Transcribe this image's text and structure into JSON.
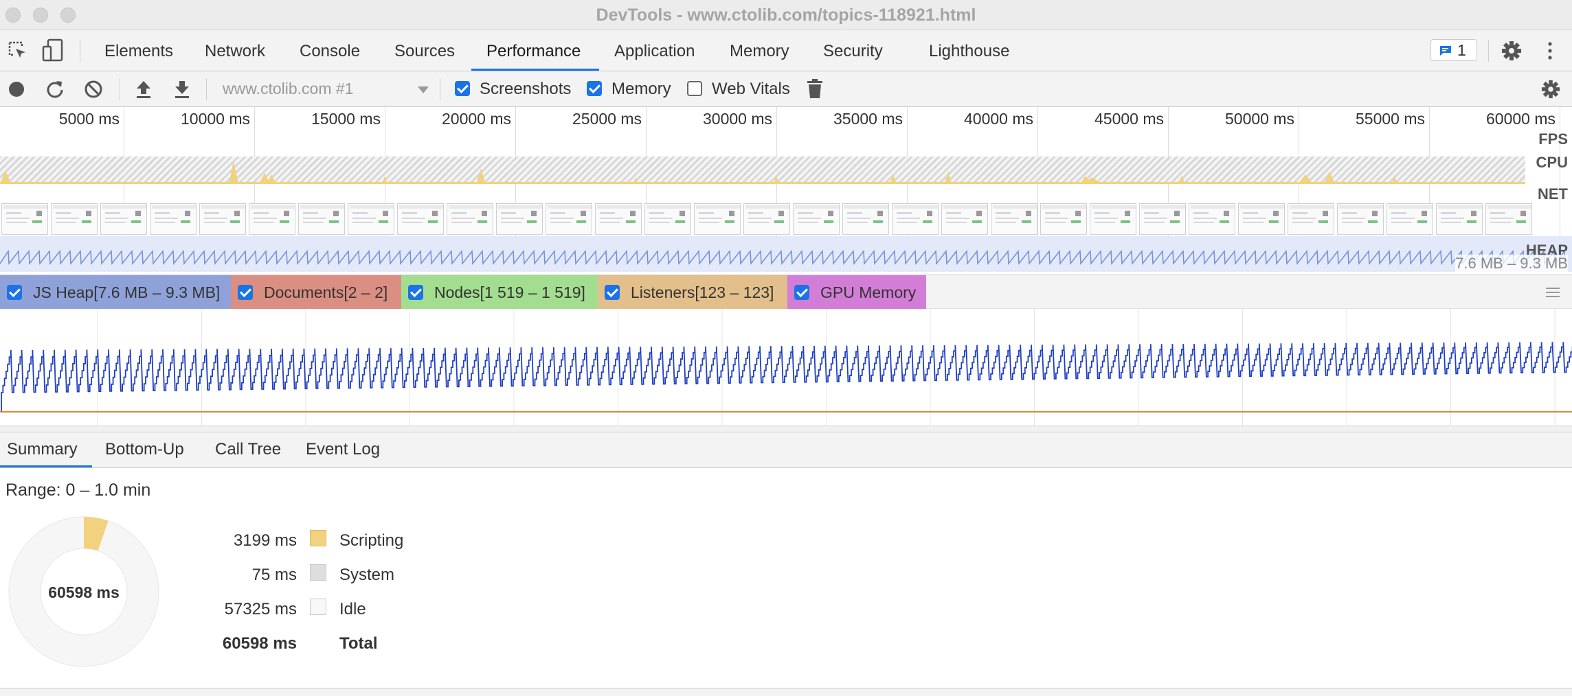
{
  "window": {
    "title": "DevTools - www.ctolib.com/topics-118921.html"
  },
  "tabs": [
    {
      "label": "Elements"
    },
    {
      "label": "Network"
    },
    {
      "label": "Console"
    },
    {
      "label": "Sources"
    },
    {
      "label": "Performance",
      "active": true
    },
    {
      "label": "Application"
    },
    {
      "label": "Memory"
    },
    {
      "label": "Security"
    },
    {
      "label": "Lighthouse"
    }
  ],
  "issues_badge": {
    "count": "1"
  },
  "toolbar": {
    "profile_select": "www.ctolib.com #1",
    "screenshots": {
      "label": "Screenshots",
      "checked": true
    },
    "memory": {
      "label": "Memory",
      "checked": true
    },
    "web_vitals": {
      "label": "Web Vitals",
      "checked": false
    }
  },
  "overview": {
    "ticks": [
      "5000 ms",
      "10000 ms",
      "15000 ms",
      "20000 ms",
      "25000 ms",
      "30000 ms",
      "35000 ms",
      "40000 ms",
      "45000 ms",
      "50000 ms",
      "55000 ms",
      "60000 ms"
    ],
    "tracks": {
      "fps": "FPS",
      "cpu": "CPU",
      "net": "NET",
      "heap": "HEAP"
    },
    "heap_range": "7.6 MB – 9.3 MB"
  },
  "counters": [
    {
      "label": "JS Heap[7.6 MB – 9.3 MB]",
      "color": "#8ea2d9"
    },
    {
      "label": "Documents[2 – 2]",
      "color": "#db8f82"
    },
    {
      "label": "Nodes[1 519 – 1 519]",
      "color": "#a3dd8f"
    },
    {
      "label": "Listeners[123 – 123]",
      "color": "#e2bf8b"
    },
    {
      "label": "GPU Memory",
      "color": "#d37ed6"
    }
  ],
  "bottom_tabs": [
    {
      "label": "Summary",
      "active": true
    },
    {
      "label": "Bottom-Up"
    },
    {
      "label": "Call Tree"
    },
    {
      "label": "Event Log"
    }
  ],
  "summary": {
    "range": "Range: 0 – 1.0 min",
    "total_center": "60598 ms",
    "rows": [
      {
        "value": "3199 ms",
        "label": "Scripting",
        "color": "#f2d27e"
      },
      {
        "value": "75 ms",
        "label": "System",
        "color": "#dedede"
      },
      {
        "value": "57325 ms",
        "label": "Idle",
        "color": "#f8f8f8"
      }
    ],
    "total": {
      "value": "60598 ms",
      "label": "Total"
    }
  },
  "colors": {
    "accent": "#1a73e8",
    "heap_line": "#1f3fc2",
    "listeners_line": "#e1862f",
    "scripting": "#f2d27e"
  }
}
